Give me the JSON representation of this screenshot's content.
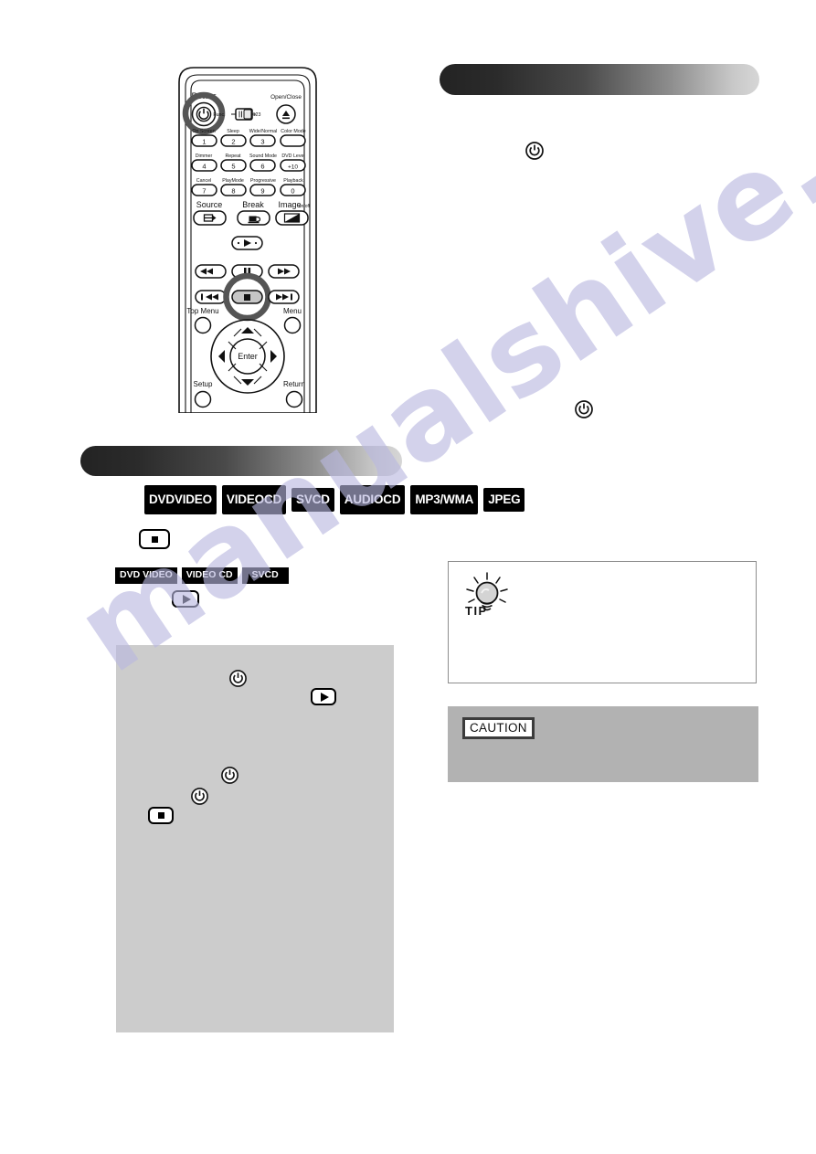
{
  "document": {
    "type": "dvd-player-user-manual-page",
    "watermark_text": "manualshive.com"
  },
  "remote": {
    "title": "remote control diagram",
    "labels": {
      "power": "Power",
      "open_close": "Open/Close",
      "func": "Func.",
      "numeric": "123",
      "on_screen": "On Screen",
      "sleep": "Sleep",
      "wide_normal": "Wide/Normal",
      "color_mode": "Color Mode",
      "dimmer": "Dimmer",
      "repeat": "Repeat",
      "sound_mode": "Sound Mode",
      "dvd_level": "DVD Level",
      "cancel": "Cancel",
      "play_mode": "PlayMode",
      "progressive": "Progressive",
      "playback": "Playback",
      "source": "Source",
      "break": "Break",
      "image": "Image",
      "image_onoff": "on/off",
      "top_menu": "Top Menu",
      "menu": "Menu",
      "setup": "Setup",
      "return": "Return",
      "enter": "Enter"
    },
    "number_keys": [
      {
        "key": "1",
        "fn": "On Screen"
      },
      {
        "key": "2",
        "fn": "Sleep"
      },
      {
        "key": "3",
        "fn": "Wide/Normal"
      },
      {
        "key": "",
        "fn": "Color Mode"
      },
      {
        "key": "4",
        "fn": "Dimmer"
      },
      {
        "key": "5",
        "fn": "Repeat"
      },
      {
        "key": "6",
        "fn": "Sound Mode"
      },
      {
        "key": "+10",
        "fn": "DVD Level"
      },
      {
        "key": "7",
        "fn": "Cancel"
      },
      {
        "key": "8",
        "fn": "PlayMode"
      },
      {
        "key": "9",
        "fn": "Progressive"
      },
      {
        "key": "0",
        "fn": "Playback"
      }
    ],
    "highlighted_buttons": [
      "power-button",
      "stop-button"
    ]
  },
  "disc_badges": [
    {
      "line1": "DVD",
      "line2": "VIDEO",
      "lines": 2
    },
    {
      "line1": "VIDEO",
      "line2": "CD",
      "lines": 2
    },
    {
      "line1": "SVCD",
      "line2": "",
      "lines": 1
    },
    {
      "line1": "AUDIO",
      "line2": "CD",
      "lines": 2
    },
    {
      "line1": "MP3/",
      "line2": "WMA",
      "lines": 2
    },
    {
      "line1": "JPEG",
      "line2": "",
      "lines": 1
    }
  ],
  "inline_badges": [
    "DVD VIDEO",
    "VIDEO CD",
    "SVCD"
  ],
  "tip": {
    "label": "TIP"
  },
  "caution": {
    "label": "CAUTION"
  },
  "colors": {
    "page_background": "#ffffff",
    "gradient_dark": "#232323",
    "gradient_light": "#d6d6d6",
    "gray_box": "#cccccc",
    "caution_box": "#b2b2b2",
    "badge_background": "#000000",
    "badge_text": "#ffffff",
    "watermark": "#b9b8e0"
  }
}
